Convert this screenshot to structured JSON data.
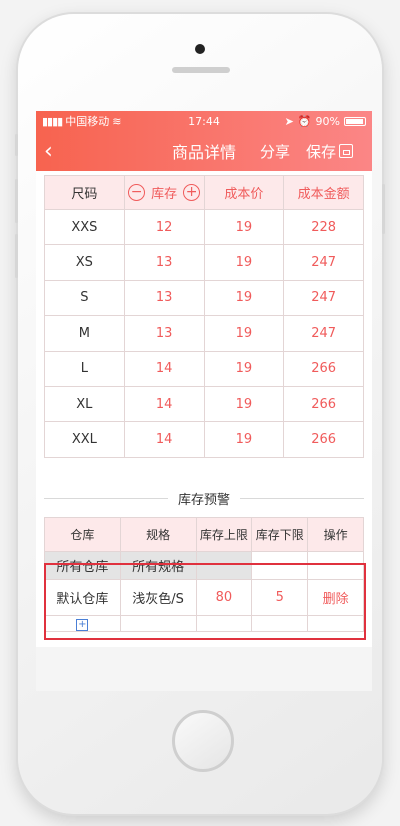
{
  "status": {
    "carrier": "中国移动",
    "time": "17:44",
    "battery": "90%"
  },
  "nav": {
    "back": "‹",
    "title": "商品详情",
    "share": "分享",
    "save": "保存"
  },
  "size_table": {
    "headers": [
      "尺码",
      "库存",
      "成本价",
      "成本金额"
    ],
    "stock_minus": "−",
    "stock_plus": "+",
    "rows": [
      {
        "size": "XXS",
        "stock": "12",
        "cost": "19",
        "amount": "228"
      },
      {
        "size": "XS",
        "stock": "13",
        "cost": "19",
        "amount": "247"
      },
      {
        "size": "S",
        "stock": "13",
        "cost": "19",
        "amount": "247"
      },
      {
        "size": "M",
        "stock": "13",
        "cost": "19",
        "amount": "247"
      },
      {
        "size": "L",
        "stock": "14",
        "cost": "19",
        "amount": "266"
      },
      {
        "size": "XL",
        "stock": "14",
        "cost": "19",
        "amount": "266"
      },
      {
        "size": "XXL",
        "stock": "14",
        "cost": "19",
        "amount": "266"
      }
    ]
  },
  "warning": {
    "section_title": "库存预警",
    "headers": [
      "仓库",
      "规格",
      "库存上限",
      "库存下限",
      "操作"
    ],
    "all_row": {
      "warehouse": "所有仓库",
      "spec": "所有规格"
    },
    "row": {
      "warehouse": "默认仓库",
      "spec": "浅灰色/S",
      "upper": "80",
      "lower": "5",
      "action": "删除"
    },
    "add_icon": "+"
  },
  "colors": {
    "accent": "#f05b5b",
    "header_gradient_start": "#f7634f",
    "header_gradient_end": "#fb8686",
    "highlight": "#e0313e"
  }
}
